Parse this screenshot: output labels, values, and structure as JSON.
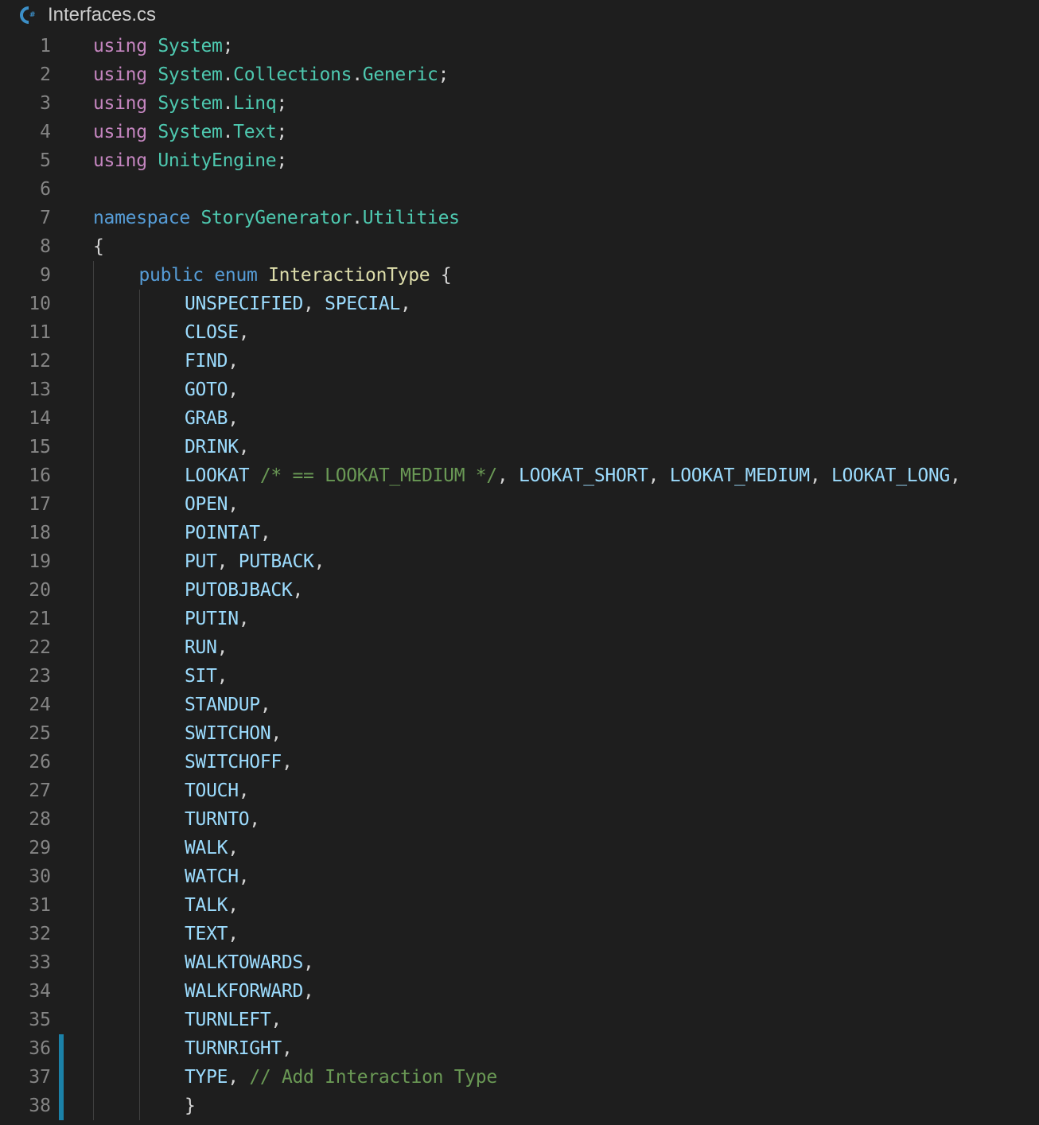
{
  "tab": {
    "icon": "csharp-file-icon",
    "icon_text": "C#",
    "title": "Interfaces.cs"
  },
  "colors": {
    "background": "#1e1e1e",
    "line_number": "#858585",
    "keyword_control": "#c586c0",
    "keyword": "#569cd6",
    "namespace": "#4ec9b0",
    "type": "#dcdcaa",
    "enum_member": "#9cdcfe",
    "comment": "#6a9955",
    "punctuation": "#d4d4d4",
    "modified_gutter": "#1b81a8"
  },
  "editor": {
    "lines": [
      {
        "number": "1",
        "indent": 0,
        "tokens": [
          {
            "t": "using",
            "c": "kw-ctrl"
          },
          {
            "t": " ",
            "c": "punct"
          },
          {
            "t": "System",
            "c": "ns"
          },
          {
            "t": ";",
            "c": "punct"
          }
        ]
      },
      {
        "number": "2",
        "indent": 0,
        "tokens": [
          {
            "t": "using",
            "c": "kw-ctrl"
          },
          {
            "t": " ",
            "c": "punct"
          },
          {
            "t": "System",
            "c": "ns"
          },
          {
            "t": ".",
            "c": "punct"
          },
          {
            "t": "Collections",
            "c": "ns"
          },
          {
            "t": ".",
            "c": "punct"
          },
          {
            "t": "Generic",
            "c": "ns"
          },
          {
            "t": ";",
            "c": "punct"
          }
        ]
      },
      {
        "number": "3",
        "indent": 0,
        "tokens": [
          {
            "t": "using",
            "c": "kw-ctrl"
          },
          {
            "t": " ",
            "c": "punct"
          },
          {
            "t": "System",
            "c": "ns"
          },
          {
            "t": ".",
            "c": "punct"
          },
          {
            "t": "Linq",
            "c": "ns"
          },
          {
            "t": ";",
            "c": "punct"
          }
        ]
      },
      {
        "number": "4",
        "indent": 0,
        "tokens": [
          {
            "t": "using",
            "c": "kw-ctrl"
          },
          {
            "t": " ",
            "c": "punct"
          },
          {
            "t": "System",
            "c": "ns"
          },
          {
            "t": ".",
            "c": "punct"
          },
          {
            "t": "Text",
            "c": "ns"
          },
          {
            "t": ";",
            "c": "punct"
          }
        ]
      },
      {
        "number": "5",
        "indent": 0,
        "tokens": [
          {
            "t": "using",
            "c": "kw-ctrl"
          },
          {
            "t": " ",
            "c": "punct"
          },
          {
            "t": "UnityEngine",
            "c": "ns"
          },
          {
            "t": ";",
            "c": "punct"
          }
        ]
      },
      {
        "number": "6",
        "indent": 0,
        "tokens": []
      },
      {
        "number": "7",
        "indent": 0,
        "tokens": [
          {
            "t": "namespace",
            "c": "kw"
          },
          {
            "t": " ",
            "c": "punct"
          },
          {
            "t": "StoryGenerator",
            "c": "ns"
          },
          {
            "t": ".",
            "c": "punct"
          },
          {
            "t": "Utilities",
            "c": "ns"
          }
        ]
      },
      {
        "number": "8",
        "indent": 0,
        "tokens": [
          {
            "t": "{",
            "c": "punct"
          }
        ]
      },
      {
        "number": "9",
        "indent": 1,
        "tokens": [
          {
            "t": "public",
            "c": "kw"
          },
          {
            "t": " ",
            "c": "punct"
          },
          {
            "t": "enum",
            "c": "kw"
          },
          {
            "t": " ",
            "c": "punct"
          },
          {
            "t": "InteractionType",
            "c": "type"
          },
          {
            "t": " {",
            "c": "punct"
          }
        ]
      },
      {
        "number": "10",
        "indent": 2,
        "tokens": [
          {
            "t": "UNSPECIFIED",
            "c": "const"
          },
          {
            "t": ", ",
            "c": "punct"
          },
          {
            "t": "SPECIAL",
            "c": "const"
          },
          {
            "t": ",",
            "c": "punct"
          }
        ]
      },
      {
        "number": "11",
        "indent": 2,
        "tokens": [
          {
            "t": "CLOSE",
            "c": "const"
          },
          {
            "t": ",",
            "c": "punct"
          }
        ]
      },
      {
        "number": "12",
        "indent": 2,
        "tokens": [
          {
            "t": "FIND",
            "c": "const"
          },
          {
            "t": ",",
            "c": "punct"
          }
        ]
      },
      {
        "number": "13",
        "indent": 2,
        "tokens": [
          {
            "t": "GOTO",
            "c": "const"
          },
          {
            "t": ",",
            "c": "punct"
          }
        ]
      },
      {
        "number": "14",
        "indent": 2,
        "tokens": [
          {
            "t": "GRAB",
            "c": "const"
          },
          {
            "t": ",",
            "c": "punct"
          }
        ]
      },
      {
        "number": "15",
        "indent": 2,
        "tokens": [
          {
            "t": "DRINK",
            "c": "const"
          },
          {
            "t": ",",
            "c": "punct"
          }
        ]
      },
      {
        "number": "16",
        "indent": 2,
        "tokens": [
          {
            "t": "LOOKAT",
            "c": "const"
          },
          {
            "t": " ",
            "c": "punct"
          },
          {
            "t": "/* == LOOKAT_MEDIUM */",
            "c": "comment"
          },
          {
            "t": ", ",
            "c": "punct"
          },
          {
            "t": "LOOKAT_SHORT",
            "c": "const"
          },
          {
            "t": ", ",
            "c": "punct"
          },
          {
            "t": "LOOKAT_MEDIUM",
            "c": "const"
          },
          {
            "t": ", ",
            "c": "punct"
          },
          {
            "t": "LOOKAT_LONG",
            "c": "const"
          },
          {
            "t": ",",
            "c": "punct"
          }
        ]
      },
      {
        "number": "17",
        "indent": 2,
        "tokens": [
          {
            "t": "OPEN",
            "c": "const"
          },
          {
            "t": ",",
            "c": "punct"
          }
        ]
      },
      {
        "number": "18",
        "indent": 2,
        "tokens": [
          {
            "t": "POINTAT",
            "c": "const"
          },
          {
            "t": ",",
            "c": "punct"
          }
        ]
      },
      {
        "number": "19",
        "indent": 2,
        "tokens": [
          {
            "t": "PUT",
            "c": "const"
          },
          {
            "t": ", ",
            "c": "punct"
          },
          {
            "t": "PUTBACK",
            "c": "const"
          },
          {
            "t": ",",
            "c": "punct"
          }
        ]
      },
      {
        "number": "20",
        "indent": 2,
        "tokens": [
          {
            "t": "PUTOBJBACK",
            "c": "const"
          },
          {
            "t": ",",
            "c": "punct"
          }
        ]
      },
      {
        "number": "21",
        "indent": 2,
        "tokens": [
          {
            "t": "PUTIN",
            "c": "const"
          },
          {
            "t": ",",
            "c": "punct"
          }
        ]
      },
      {
        "number": "22",
        "indent": 2,
        "tokens": [
          {
            "t": "RUN",
            "c": "const"
          },
          {
            "t": ",",
            "c": "punct"
          }
        ]
      },
      {
        "number": "23",
        "indent": 2,
        "tokens": [
          {
            "t": "SIT",
            "c": "const"
          },
          {
            "t": ",",
            "c": "punct"
          }
        ]
      },
      {
        "number": "24",
        "indent": 2,
        "tokens": [
          {
            "t": "STANDUP",
            "c": "const"
          },
          {
            "t": ",",
            "c": "punct"
          }
        ]
      },
      {
        "number": "25",
        "indent": 2,
        "tokens": [
          {
            "t": "SWITCHON",
            "c": "const"
          },
          {
            "t": ",",
            "c": "punct"
          }
        ]
      },
      {
        "number": "26",
        "indent": 2,
        "tokens": [
          {
            "t": "SWITCHOFF",
            "c": "const"
          },
          {
            "t": ",",
            "c": "punct"
          }
        ]
      },
      {
        "number": "27",
        "indent": 2,
        "tokens": [
          {
            "t": "TOUCH",
            "c": "const"
          },
          {
            "t": ",",
            "c": "punct"
          }
        ]
      },
      {
        "number": "28",
        "indent": 2,
        "tokens": [
          {
            "t": "TURNTO",
            "c": "const"
          },
          {
            "t": ",",
            "c": "punct"
          }
        ]
      },
      {
        "number": "29",
        "indent": 2,
        "tokens": [
          {
            "t": "WALK",
            "c": "const"
          },
          {
            "t": ",",
            "c": "punct"
          }
        ]
      },
      {
        "number": "30",
        "indent": 2,
        "tokens": [
          {
            "t": "WATCH",
            "c": "const"
          },
          {
            "t": ",",
            "c": "punct"
          }
        ]
      },
      {
        "number": "31",
        "indent": 2,
        "tokens": [
          {
            "t": "TALK",
            "c": "const"
          },
          {
            "t": ",",
            "c": "punct"
          }
        ]
      },
      {
        "number": "32",
        "indent": 2,
        "tokens": [
          {
            "t": "TEXT",
            "c": "const"
          },
          {
            "t": ",",
            "c": "punct"
          }
        ]
      },
      {
        "number": "33",
        "indent": 2,
        "tokens": [
          {
            "t": "WALKTOWARDS",
            "c": "const"
          },
          {
            "t": ",",
            "c": "punct"
          }
        ]
      },
      {
        "number": "34",
        "indent": 2,
        "tokens": [
          {
            "t": "WALKFORWARD",
            "c": "const"
          },
          {
            "t": ",",
            "c": "punct"
          }
        ]
      },
      {
        "number": "35",
        "indent": 2,
        "tokens": [
          {
            "t": "TURNLEFT",
            "c": "const"
          },
          {
            "t": ",",
            "c": "punct"
          }
        ]
      },
      {
        "number": "36",
        "indent": 2,
        "modified": true,
        "tokens": [
          {
            "t": "TURNRIGHT",
            "c": "const"
          },
          {
            "t": ",",
            "c": "punct"
          }
        ]
      },
      {
        "number": "37",
        "indent": 2,
        "modified": true,
        "tokens": [
          {
            "t": "TYPE",
            "c": "const"
          },
          {
            "t": ", ",
            "c": "punct"
          },
          {
            "t": "// Add Interaction Type",
            "c": "comment"
          }
        ]
      },
      {
        "number": "38",
        "indent": 2,
        "modified": true,
        "tokens": [
          {
            "t": "}",
            "c": "punct"
          }
        ]
      }
    ]
  }
}
